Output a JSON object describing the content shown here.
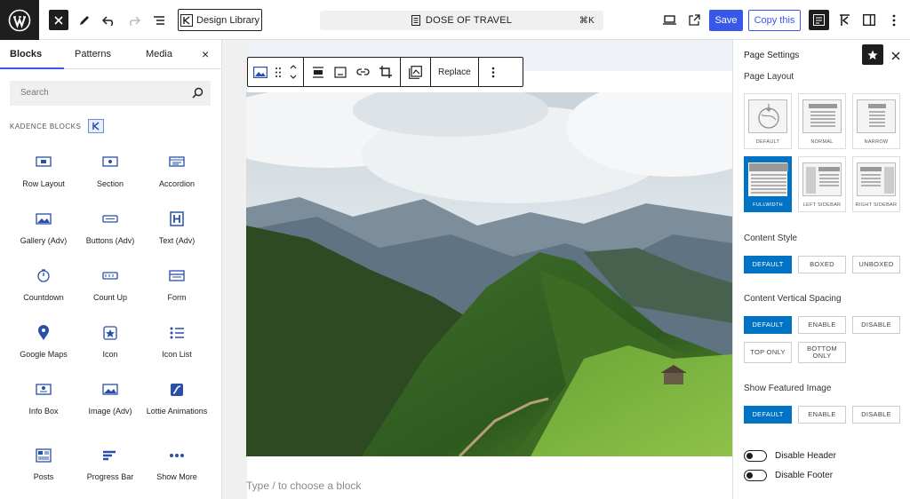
{
  "topbar": {
    "design_library": "Design Library",
    "doc_title": "DOSE OF TRAVEL",
    "shortcut": "⌘K",
    "save": "Save",
    "copy": "Copy this"
  },
  "left_panel": {
    "tabs": [
      "Blocks",
      "Patterns",
      "Media"
    ],
    "search_placeholder": "Search",
    "section_label": "KADENCE BLOCKS",
    "blocks": [
      {
        "label": "Row Layout",
        "icon": "row-layout-icon"
      },
      {
        "label": "Section",
        "icon": "section-icon"
      },
      {
        "label": "Accordion",
        "icon": "accordion-icon"
      },
      {
        "label": "Gallery (Adv)",
        "icon": "gallery-icon"
      },
      {
        "label": "Buttons (Adv)",
        "icon": "buttons-icon"
      },
      {
        "label": "Text (Adv)",
        "icon": "text-heading-icon"
      },
      {
        "label": "Countdown",
        "icon": "countdown-icon"
      },
      {
        "label": "Count Up",
        "icon": "count-up-icon"
      },
      {
        "label": "Form",
        "icon": "form-icon"
      },
      {
        "label": "Google Maps",
        "icon": "map-pin-icon"
      },
      {
        "label": "Icon",
        "icon": "icon-block-icon"
      },
      {
        "label": "Icon List",
        "icon": "icon-list-icon"
      },
      {
        "label": "Info Box",
        "icon": "info-box-icon"
      },
      {
        "label": "Image (Adv)",
        "icon": "image-icon"
      },
      {
        "label": "Lottie Animations",
        "icon": "lottie-icon"
      },
      {
        "label": "Posts",
        "icon": "posts-icon"
      },
      {
        "label": "Progress Bar",
        "icon": "progress-bar-icon"
      },
      {
        "label": "Show More",
        "icon": "show-more-icon"
      }
    ]
  },
  "editor": {
    "replace": "Replace",
    "placeholder": "Type / to choose a block"
  },
  "right_panel": {
    "title": "Page Settings",
    "page_layout_label": "Page Layout",
    "layouts": [
      "DEFAULT",
      "NORMAL",
      "NARROW",
      "FULLWIDTH",
      "LEFT SIDEBAR",
      "RIGHT SIDEBAR"
    ],
    "selected_layout": "FULLWIDTH",
    "content_style_label": "Content Style",
    "content_style": [
      "DEFAULT",
      "BOXED",
      "UNBOXED"
    ],
    "vertical_spacing_label": "Content Vertical Spacing",
    "vertical_spacing": [
      "DEFAULT",
      "ENABLE",
      "DISABLE",
      "TOP ONLY",
      "BOTTOM ONLY"
    ],
    "featured_image_label": "Show Featured Image",
    "featured_image": [
      "DEFAULT",
      "ENABLE",
      "DISABLE"
    ],
    "disable_header": "Disable Header",
    "disable_footer": "Disable Footer"
  },
  "colors": {
    "accent": "#3858e9",
    "selected": "#0073c4",
    "dark": "#1e1e1e"
  }
}
